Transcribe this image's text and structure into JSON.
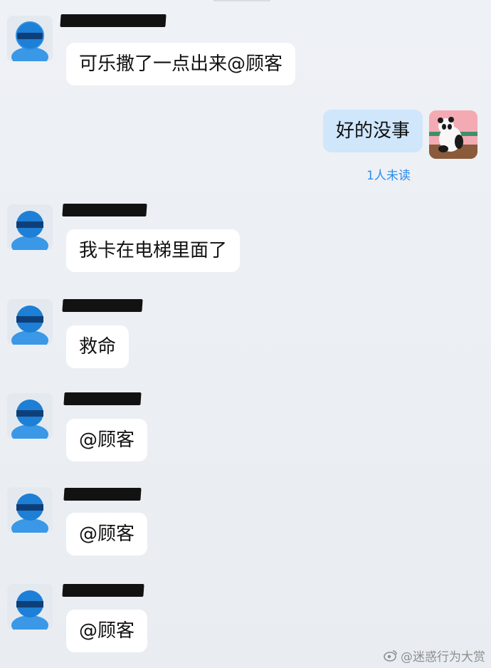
{
  "messages": [
    {
      "sender": "other",
      "text": "可乐撒了一点出来@顾客"
    },
    {
      "sender": "self",
      "text": "好的没事",
      "read_status": "1人未读"
    },
    {
      "sender": "other",
      "text": "我卡在电梯里面了"
    },
    {
      "sender": "other",
      "text": "救命"
    },
    {
      "sender": "other",
      "text": "@顾客"
    },
    {
      "sender": "other",
      "text": "@顾客"
    },
    {
      "sender": "other",
      "text": "@顾客"
    }
  ],
  "watermark": {
    "text": "@迷惑行为大赏",
    "icon": "weibo-icon"
  },
  "colors": {
    "bubble_other": "#ffffff",
    "bubble_self": "#cfe6fb",
    "read_status": "#2a8df0",
    "avatar_blue": "#1d7fd6"
  }
}
